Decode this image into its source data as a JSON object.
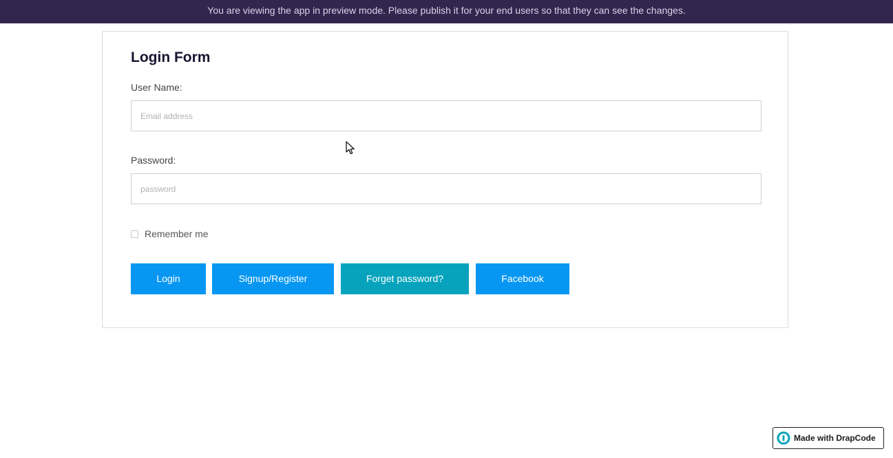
{
  "banner": {
    "text": "You are viewing the app in preview mode. Please publish it for your end users so that they can see the changes."
  },
  "form": {
    "title": "Login Form",
    "username": {
      "label": "User Name:",
      "placeholder": "Email address",
      "value": ""
    },
    "password": {
      "label": "Password:",
      "placeholder": "password",
      "value": ""
    },
    "remember": {
      "label": "Remember me",
      "checked": false
    },
    "buttons": {
      "login": "Login",
      "signup": "Signup/Register",
      "forget": "Forget password?",
      "facebook": "Facebook"
    }
  },
  "badge": {
    "text": "Made with DrapCode",
    "icon": "drapcode-logo-icon"
  },
  "colors": {
    "banner_bg": "#33264e",
    "primary_button": "#0797f2",
    "secondary_button": "#07a3bd",
    "logo_accent": "#0aa3b8"
  }
}
